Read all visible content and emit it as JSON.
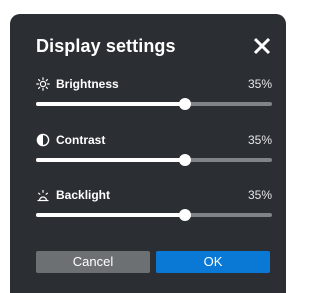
{
  "dialog": {
    "title": "Display settings",
    "close_icon": "close-icon"
  },
  "settings": [
    {
      "icon": "sun-icon",
      "label": "Brightness",
      "value_text": "35%",
      "value": 0.63
    },
    {
      "icon": "contrast-icon",
      "label": "Contrast",
      "value_text": "35%",
      "value": 0.63
    },
    {
      "icon": "backlight-icon",
      "label": "Backlight",
      "value_text": "35%",
      "value": 0.63
    }
  ],
  "buttons": {
    "cancel_label": "Cancel",
    "ok_label": "OK"
  },
  "colors": {
    "dialog_bg": "#2b2f33",
    "track": "#808387",
    "fill": "#ffffff",
    "cancel_bg": "#6d7073",
    "ok_bg": "#0a79d6"
  }
}
